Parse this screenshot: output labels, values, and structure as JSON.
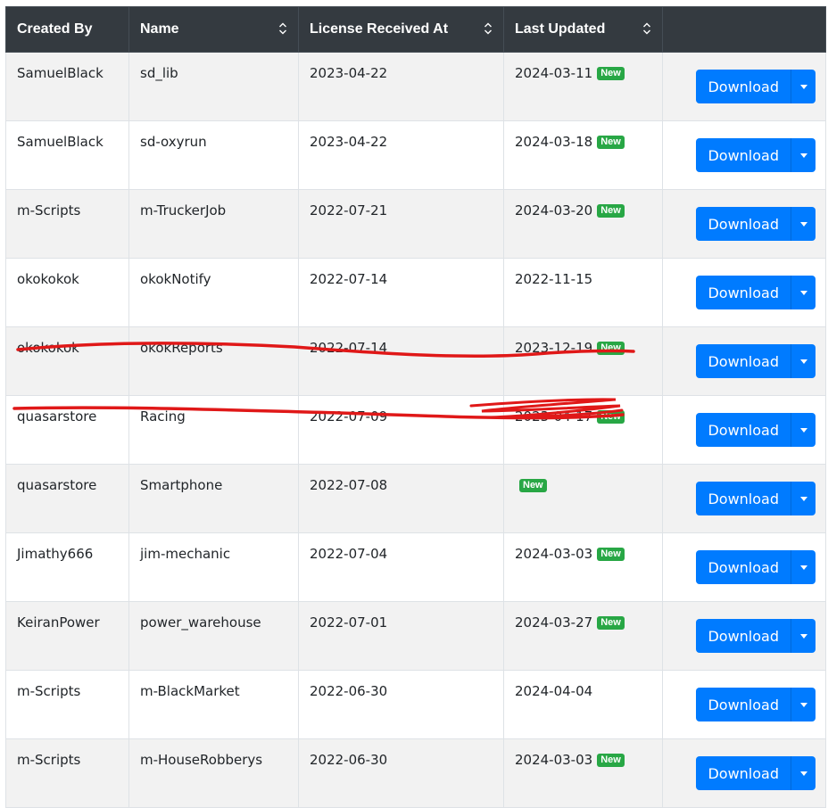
{
  "table": {
    "headers": {
      "created_by": "Created By",
      "name": "Name",
      "license_received_at": "License Received At",
      "last_updated": "Last Updated"
    },
    "download_label": "Download",
    "new_badge": "New",
    "rows": [
      {
        "created_by": "SamuelBlack",
        "name": "sd_lib",
        "license": "2023-04-22",
        "updated": "2024-03-11",
        "is_new": true
      },
      {
        "created_by": "SamuelBlack",
        "name": "sd-oxyrun",
        "license": "2023-04-22",
        "updated": "2024-03-18",
        "is_new": true
      },
      {
        "created_by": "m-Scripts",
        "name": "m-TruckerJob",
        "license": "2022-07-21",
        "updated": "2024-03-20",
        "is_new": true
      },
      {
        "created_by": "okokokok",
        "name": "okokNotify",
        "license": "2022-07-14",
        "updated": "2022-11-15",
        "is_new": false
      },
      {
        "created_by": "okokokok",
        "name": "okokReports",
        "license": "2022-07-14",
        "updated": "2023-12-19",
        "is_new": true
      },
      {
        "created_by": "quasarstore",
        "name": "Racing",
        "license": "2022-07-09",
        "updated": "2023-04-17",
        "is_new": true
      },
      {
        "created_by": "quasarstore",
        "name": "Smartphone",
        "license": "2022-07-08",
        "updated": "",
        "is_new": true
      },
      {
        "created_by": "Jimathy666",
        "name": "jim-mechanic",
        "license": "2022-07-04",
        "updated": "2024-03-03",
        "is_new": true
      },
      {
        "created_by": "KeiranPower",
        "name": "power_warehouse",
        "license": "2022-07-01",
        "updated": "2024-03-27",
        "is_new": true
      },
      {
        "created_by": "m-Scripts",
        "name": "m-BlackMarket",
        "license": "2022-06-30",
        "updated": "2024-04-04",
        "is_new": false
      },
      {
        "created_by": "m-Scripts",
        "name": "m-HouseRobberys",
        "license": "2022-06-30",
        "updated": "2024-03-03",
        "is_new": true
      }
    ]
  },
  "colors": {
    "header_bg": "#343a40",
    "button_primary": "#007bff",
    "badge_new": "#28a745",
    "stripe": "#f2f2f2",
    "redaction_stroke": "#e01818"
  },
  "icons": {
    "sort": "sort-arrows-icon",
    "caret": "caret-down-icon"
  }
}
